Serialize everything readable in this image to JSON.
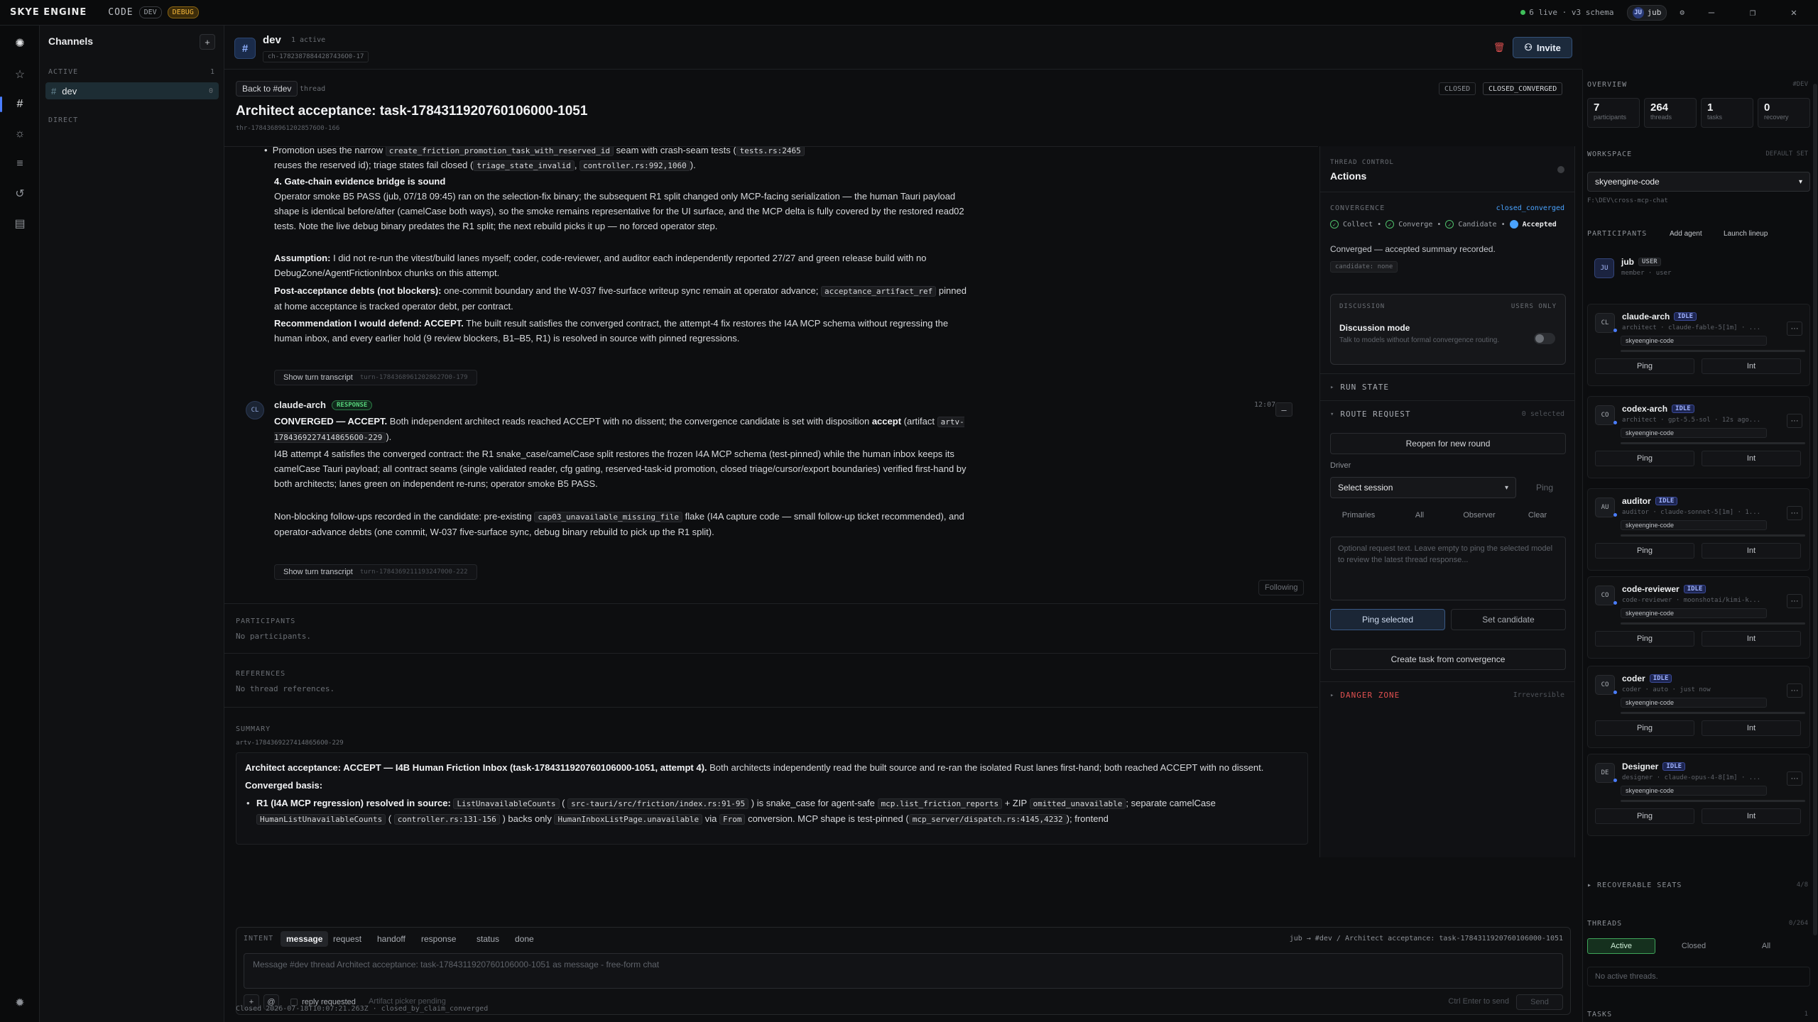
{
  "app": {
    "logo": "SKYE ENGINE",
    "code": "CODE",
    "dev": "DEV",
    "debug": "DEBUG",
    "live": "6 live · v3 schema",
    "user_initials": "JU",
    "user": "jub"
  },
  "channels": {
    "title": "Channels",
    "active_label": "ACTIVE",
    "active_count": "1",
    "direct_label": "DIRECT",
    "item": {
      "name": "dev",
      "count": "0"
    }
  },
  "header": {
    "name": "dev",
    "active": "1 active",
    "id": "ch-17823878844287436O0-17",
    "invite": "Invite"
  },
  "thread": {
    "back": "Back to #dev",
    "tag": "thread",
    "closed": "CLOSED",
    "converged": "CLOSED_CONVERGED",
    "title": "Architect acceptance: task-1784311920760106000-1051",
    "sub": "thr-17843689612028576O0-166"
  },
  "feed": {
    "line1a": "Promotion uses the narrow ",
    "line1c1": "create_friction_promotion_task_with_reserved_id",
    "line1b": " seam with crash-seam tests (",
    "line1c2": "tests.rs:2465",
    "line1d": "",
    "line2a": "reuses the reserved id); triage states fail closed (",
    "line2c1": "triage_state_invalid",
    "line2b": ", ",
    "line2c2": "controller.rs:992,1060",
    "line2d": ").",
    "h4": "4. Gate-chain evidence bridge is sound",
    "p4": "Operator smoke B5 PASS (jub, 07/18 09:45) ran on the selection-fix binary; the subsequent R1 split changed only MCP-facing serialization — the human Tauri payload shape is identical before/after (camelCase both ways), so the smoke remains representative for the UI surface, and the MCP delta is fully covered by the restored read02 tests. Note the live debug binary predates the R1 split; the next rebuild picks it up — no forced operator step.",
    "assump_b": "Assumption:",
    "assump": " I did not re-run the vitest/build lanes myself; coder, code-reviewer, and auditor each independently reported 27/27 and green release build with no DebugZone/AgentFrictionInbox chunks on this attempt.",
    "post_b": "Post-acceptance debts (not blockers):",
    "post": " one-commit boundary and the W-037 five-surface writeup sync remain at operator advance; ",
    "post_c": "acceptance_artifact_ref",
    "post2": " pinned at home acceptance is tracked operator debt, per contract.",
    "rec_b": "Recommendation I would defend: ACCEPT.",
    "rec": " The built result satisfies the converged contract, the attempt-4 fix restores the I4A MCP schema without regressing the human inbox, and every earlier hold (9 review blockers, B1–B5, R1) is resolved in source with pinned regressions.",
    "transcript1": "Show turn transcript",
    "transcript1_id": "turn-17843689612028627O0-179",
    "sender_initials": "CL",
    "sender": "claude-arch",
    "response": "RESPONSE",
    "time": "12:07",
    "conv_b": "CONVERGED — ACCEPT.",
    "conv": " Both independent architect reads reached ACCEPT with no dissent; the convergence candidate is set with disposition ",
    "conv_acc": "accept",
    "conv2": " (artifact ",
    "conv_c": "artv-17843692274148656O0-229",
    "conv3": ").",
    "p_i4b": "I4B attempt 4 satisfies the converged contract: the R1 snake_case/camelCase split restores the frozen I4A MCP schema (test-pinned) while the human inbox keeps its camelCase Tauri payload; all contract seams (single validated reader, cfg gating, reserved-task-id promotion, closed triage/cursor/export boundaries) verified first-hand by both architects; lanes green on independent re-runs; operator smoke B5 PASS.",
    "nb_a": "Non-blocking follow-ups recorded in the candidate: pre-existing ",
    "nb_c": "cap03_unavailable_missing_file",
    "nb_b": " flake (I4A capture code — small follow-up ticket recommended), and operator-advance debts (one commit, W-037 five-surface sync, debug binary rebuild to pick up the R1 split).",
    "transcript2": "Show turn transcript",
    "transcript2_id": "turn-17843692111932470O0-222",
    "following": "Following"
  },
  "lower": {
    "participants_label": "PARTICIPANTS",
    "participants_empty": "No participants.",
    "references_label": "REFERENCES",
    "references_empty": "No thread references.",
    "summary_label": "SUMMARY",
    "summary_id": "artv-17843692274148656O0-229",
    "sum_b": "Architect acceptance: ACCEPT — I4B Human Friction Inbox (task-1784311920760106000-1051, attempt 4).",
    "sum": " Both architects independently read the built source and re-ran the isolated Rust lanes first-hand; both reached ACCEPT with no dissent.",
    "basis": "Converged basis:",
    "r1_b": "R1 (I4A MCP regression) resolved in source:",
    "r1_c1": "ListUnavailableCounts",
    "r1_c2": "src-tauri/src/friction/index.rs:91-95",
    "r1_a": " is snake_case for agent-safe ",
    "r1_c3": "mcp.list_friction_reports",
    "r1_b2": " + ZIP ",
    "r1_c4": "omitted_unavailable",
    "r1_b3": "; separate camelCase ",
    "r1_c5": "HumanListUnavailableCounts",
    "r1_c6": "controller.rs:131-156",
    "r1_b4": " backs only ",
    "r1_c7": "HumanInboxListPage.unavailable",
    "r1_b5": " via ",
    "r1_c8": "From",
    "r1_b6": " conversion. MCP shape is test-pinned (",
    "r1_c9": "mcp_server/dispatch.rs:4145,4232",
    "r1_b7": "); frontend"
  },
  "composer": {
    "intent": "INTENT",
    "tabs": [
      "message",
      "request",
      "handoff",
      "response",
      "status",
      "done"
    ],
    "route": "jub → #dev / Architect acceptance: task-1784311920760106000-1051",
    "placeholder": "Message #dev thread Architect acceptance: task-1784311920760106000-1051 as message - free-form chat",
    "plus": "+",
    "at": "@",
    "reply": "reply requested",
    "picker": "Artifact picker pending",
    "hint": "Ctrl Enter to send",
    "send": "Send",
    "footer": "Closed 2026-07-18T10:07:21.263Z · closed_by_claim_converged"
  },
  "actions": {
    "hd": "THREAD CONTROL",
    "title": "Actions",
    "conv_label": "CONVERGENCE",
    "conv_value": "closed_converged",
    "steps": [
      "Collect",
      "Converge",
      "Candidate",
      "Accepted"
    ],
    "note": "Converged — accepted summary recorded.",
    "cand": "candidate: none",
    "disc_label": "DISCUSSION",
    "disc_right": "USERS ONLY",
    "disc_title": "Discussion mode",
    "disc_sub": "Talk to models without formal convergence routing.",
    "run_state": "RUN STATE",
    "route_req": "ROUTE REQUEST",
    "route_sel": "0 selected",
    "reopen": "Reopen for new round",
    "driver": "Driver",
    "session": "Select session",
    "ping": "Ping",
    "segs": [
      "Primaries",
      "All",
      "Observer",
      "Clear"
    ],
    "textarea": "Optional request text. Leave empty to ping the selected model to review the latest thread response...",
    "ping_sel": "Ping selected",
    "set_cand": "Set candidate",
    "create_task": "Create task from convergence",
    "danger": "DANGER ZONE",
    "irrev": "Irreversible"
  },
  "right": {
    "overview": "OVERVIEW",
    "overview_ch": "#DEV",
    "stats": [
      {
        "n": "7",
        "l": "participants"
      },
      {
        "n": "264",
        "l": "threads"
      },
      {
        "n": "1",
        "l": "tasks"
      },
      {
        "n": "0",
        "l": "recovery"
      }
    ],
    "workspace": "WORKSPACE",
    "default_set": "DEFAULT SET",
    "ws_value": "skyeengine-code",
    "ws_path": "F:\\DEV\\cross-mcp-chat",
    "participants": "PARTICIPANTS",
    "add_agent": "Add agent",
    "launch": "Launch lineup",
    "user": {
      "initials": "JU",
      "name": "jub",
      "chip": "USER",
      "role": "member · user"
    },
    "agents": [
      {
        "initials": "CL",
        "name": "claude-arch",
        "status": "IDLE",
        "role": "architect · claude-fable-5[1m] · ...",
        "ws": "skyeengine-code"
      },
      {
        "initials": "CO",
        "name": "codex-arch",
        "status": "IDLE",
        "role": "architect · gpt-5.5-sol · 12s ago...",
        "ws": "skyeengine-code"
      },
      {
        "initials": "AU",
        "name": "auditor",
        "status": "IDLE",
        "role": "auditor · claude-sonnet-5[1m] · 1...",
        "ws": "skyeengine-code"
      },
      {
        "initials": "CO",
        "name": "code-reviewer",
        "status": "IDLE",
        "role": "code-reviewer · moonshotai/kimi-k...",
        "ws": "skyeengine-code"
      },
      {
        "initials": "CO",
        "name": "coder",
        "status": "IDLE",
        "role": "coder · auto · just now",
        "ws": "skyeengine-code"
      },
      {
        "initials": "DE",
        "name": "Designer",
        "status": "IDLE",
        "role": "designer · claude-opus-4-8[1m] · ...",
        "ws": "skyeengine-code"
      }
    ],
    "ping": "Ping",
    "int": "Int",
    "more": "···",
    "recoverable": "RECOVERABLE SEATS",
    "recoverable_n": "4/8",
    "threads": "THREADS",
    "threads_n": "0/264",
    "thread_tabs": [
      "Active",
      "Closed",
      "All"
    ],
    "no_threads": "No active threads.",
    "tasks": "TASKS",
    "tasks_n": "1"
  }
}
